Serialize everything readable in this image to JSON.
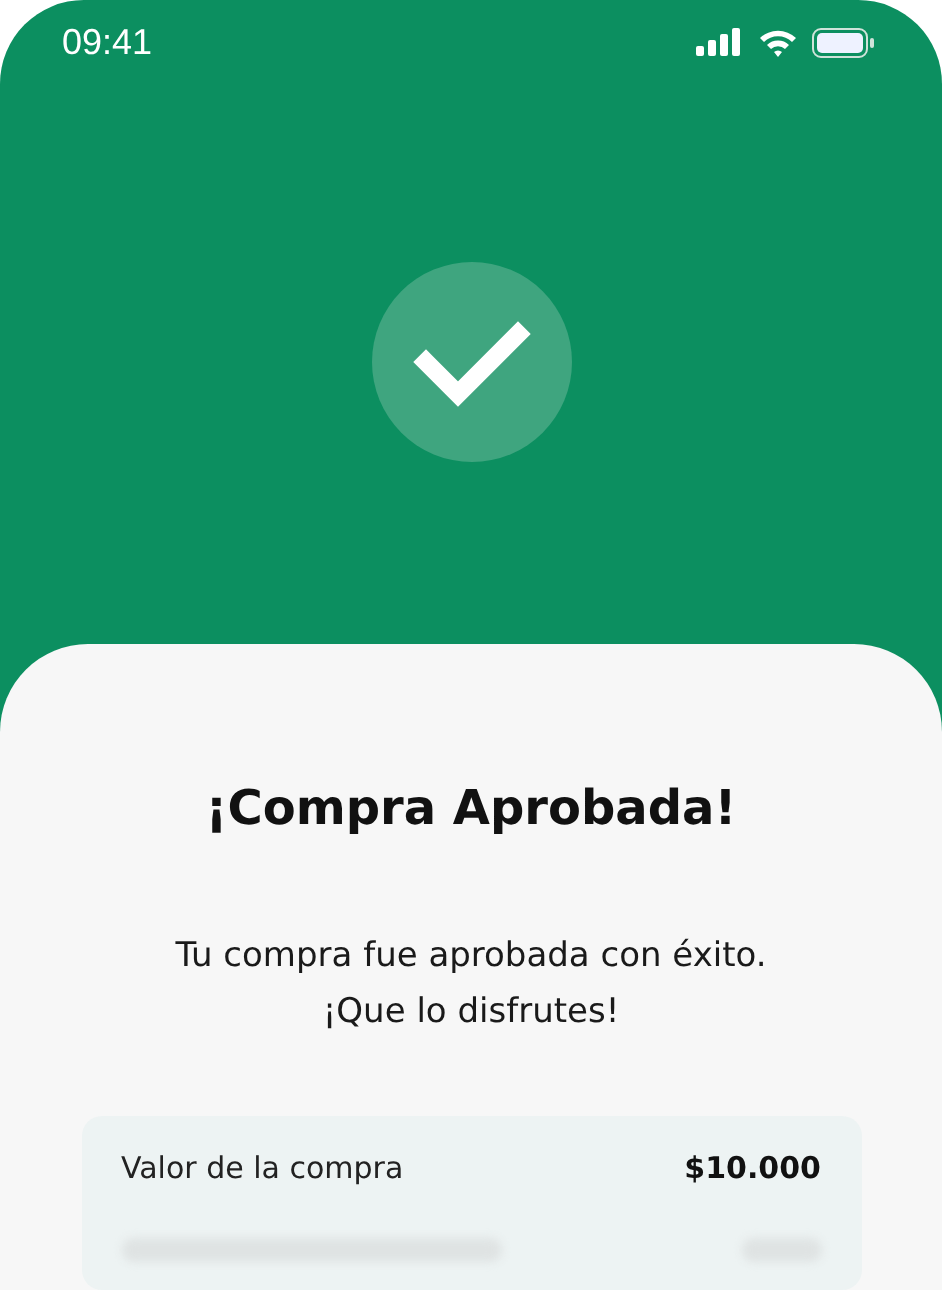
{
  "status_bar": {
    "time": "09:41"
  },
  "title": "¡Compra Aprobada!",
  "message": "Tu compra fue aprobada con éxito. ¡Que lo disfrutes!",
  "details": [
    {
      "kind": "text",
      "label": "Valor de la compra",
      "value": "$10.000"
    },
    {
      "kind": "blurred"
    }
  ]
}
